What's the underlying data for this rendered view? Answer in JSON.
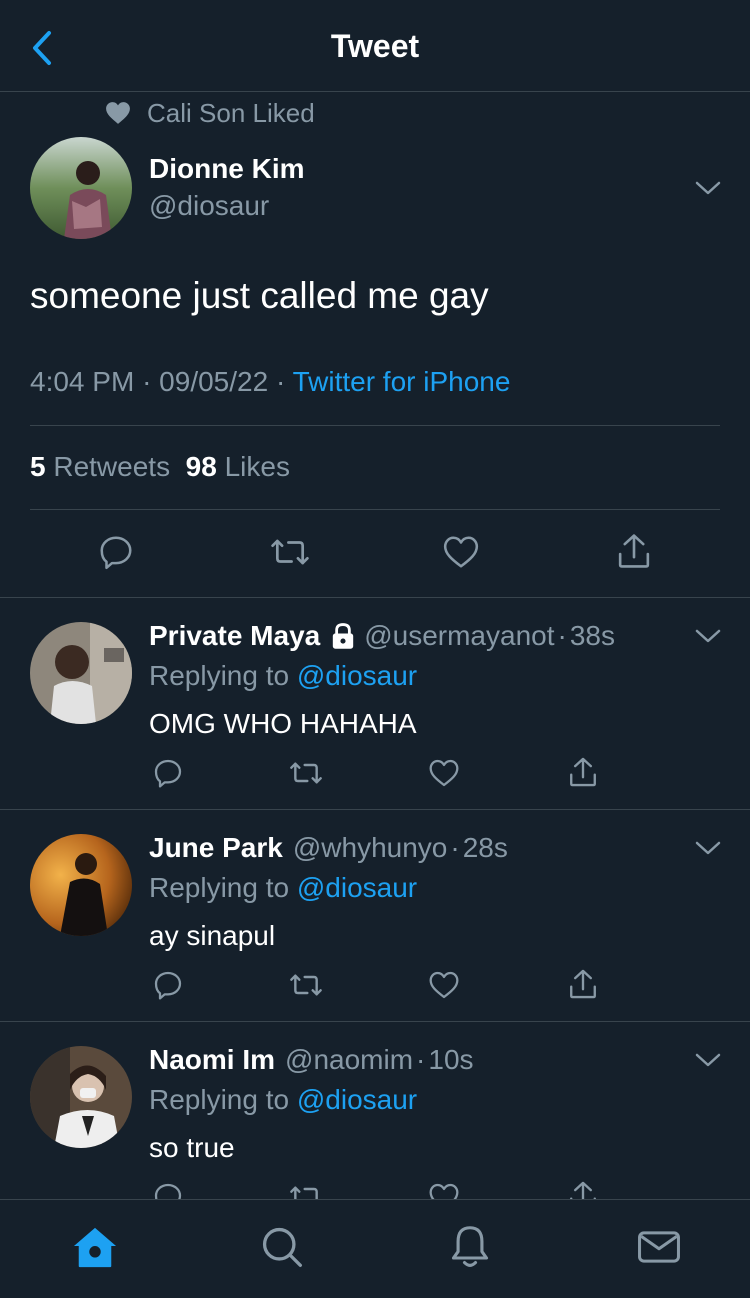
{
  "header": {
    "title": "Tweet"
  },
  "social_context": "Cali Son Liked",
  "tweet": {
    "name": "Dionne Kim",
    "handle": "@diosaur",
    "text": "someone just called me gay",
    "time": "4:04 PM",
    "date": "09/05/22",
    "separator": "·",
    "source": "Twitter for iPhone",
    "retweets": "5",
    "retweets_label": "Retweets",
    "likes": "98",
    "likes_label": "Likes"
  },
  "replying_label": "Replying to",
  "replies": [
    {
      "name": "Private Maya",
      "handle": "@usermayanot",
      "time": "38s",
      "replying_to": "@diosaur",
      "text": "OMG WHO HAHAHA",
      "locked": true
    },
    {
      "name": "June Park",
      "handle": "@whyhunyo",
      "time": "28s",
      "replying_to": "@diosaur",
      "text": "ay sinapul",
      "locked": false
    },
    {
      "name": "Naomi Im",
      "handle": "@naomim",
      "time": "10s",
      "replying_to": "@diosaur",
      "text": "so true",
      "locked": false
    }
  ],
  "colors": {
    "background": "#15202b",
    "accent": "#1da1f2",
    "muted": "#8899a6",
    "divider": "#38444d"
  },
  "icons": [
    "back-chevron-icon",
    "heart-icon",
    "chevron-down-icon",
    "reply-icon",
    "retweet-icon",
    "like-icon",
    "share-icon",
    "lock-icon",
    "home-icon",
    "search-icon",
    "notifications-icon",
    "messages-icon"
  ]
}
